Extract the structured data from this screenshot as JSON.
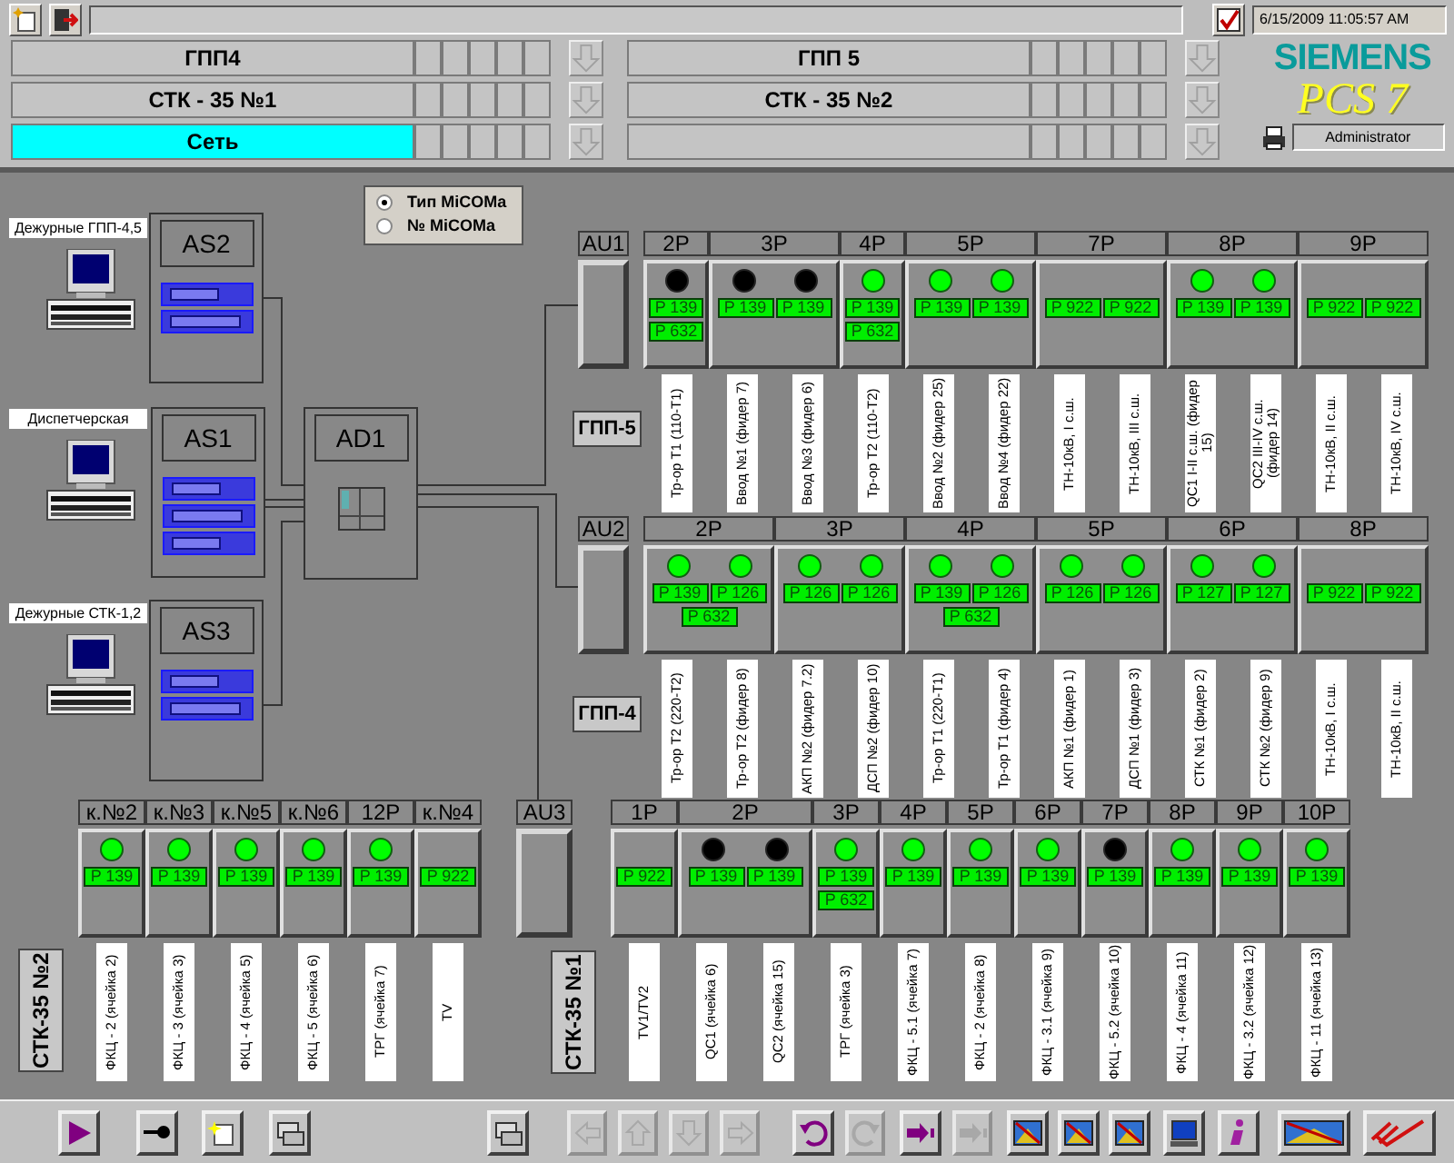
{
  "header": {
    "date_time": "6/15/2009 11:05:57 AM",
    "brand": "SIEMENS",
    "product": "PCS 7",
    "user": "Administrator"
  },
  "areas": [
    {
      "label": "ГПП4",
      "selected": false
    },
    {
      "label": "ГПП 5",
      "selected": false
    },
    {
      "label": "СТК - 35 №1",
      "selected": false
    },
    {
      "label": "СТК - 35 №2",
      "selected": false
    },
    {
      "label": "Сеть",
      "selected": true
    },
    {
      "selected": false
    }
  ],
  "network": {
    "view_options": [
      {
        "label": "Тип MiCOMa",
        "selected": true
      },
      {
        "label": "№ MiCOMa",
        "selected": false
      }
    ],
    "workstations": [
      {
        "label": "Дежурные ГПП-4,5"
      },
      {
        "label": "Диспетчерская"
      },
      {
        "label": "Дежурные СТК-1,2"
      }
    ],
    "servers": [
      {
        "name": "AS2"
      },
      {
        "name": "AS1"
      },
      {
        "name": "AS3"
      }
    ],
    "switch": {
      "name": "AD1"
    }
  },
  "relay_groups": [
    {
      "kind": "upper",
      "au": "AU1",
      "station": "ГПП-5",
      "cabinets": [
        {
          "name": "2P",
          "lamps": [
            {
              "on": false
            }
          ],
          "tags": [
            "P 139",
            "P 632"
          ],
          "labels": [
            "Тр-ор Т1 (110-Т1)"
          ]
        },
        {
          "name": "3P",
          "lamps": [
            {
              "on": false
            },
            {
              "on": false
            }
          ],
          "tags": [
            "P 139",
            "P 139"
          ],
          "labels": [
            "Ввод №1 (фидер 7)",
            "Ввод №3 (фидер 6)"
          ]
        },
        {
          "name": "4P",
          "lamps": [
            {
              "on": true
            }
          ],
          "tags": [
            "P 139",
            "P 632"
          ],
          "labels": [
            "Тр-ор Т2 (110-Т2)"
          ]
        },
        {
          "name": "5P",
          "lamps": [
            {
              "on": true
            },
            {
              "on": true
            }
          ],
          "tags": [
            "P 139",
            "P 139"
          ],
          "labels": [
            "Ввод №2 (фидер 25)",
            "Ввод №4 (фидер 22)"
          ]
        },
        {
          "name": "7P",
          "tags": [
            "P 922",
            "P 922"
          ],
          "labels": [
            "ТН-10кВ, I с.ш.",
            "ТН-10кВ, III с.ш."
          ]
        },
        {
          "name": "8P",
          "lamps": [
            {
              "on": true
            },
            {
              "on": true
            }
          ],
          "tags": [
            "P 139",
            "P 139"
          ],
          "labels": [
            "QC1 I-II с.ш. (фидер 15)",
            "QC2 III-IV с.ш. (фидер 14)"
          ]
        },
        {
          "name": "9P",
          "tags": [
            "P 922",
            "P 922"
          ],
          "labels": [
            "ТН-10кВ, II с.ш.",
            "ТН-10кВ, IV с.ш."
          ]
        }
      ]
    },
    {
      "kind": "upper",
      "au": "AU2",
      "station": "ГПП-4",
      "cabinets": [
        {
          "name": "2P",
          "lamps": [
            {
              "on": true
            },
            {
              "on": true
            }
          ],
          "tags": [
            "P 139",
            "P 126",
            "P 632"
          ],
          "labels": [
            "Тр-ор Т2 (220-Т2)",
            "Тр-ор Т2 (фидер 8)"
          ]
        },
        {
          "name": "3P",
          "lamps": [
            {
              "on": true
            },
            {
              "on": true
            }
          ],
          "tags": [
            "P 126",
            "P 126"
          ],
          "labels": [
            "АКП №2 (фидер 7.2)",
            "ДСП №2 (фидер 10)"
          ]
        },
        {
          "name": "4P",
          "lamps": [
            {
              "on": true
            },
            {
              "on": true
            }
          ],
          "tags": [
            "P 139",
            "P 126",
            "P 632"
          ],
          "labels": [
            "Тр-ор Т1 (220-Т1)",
            "Тр-ор Т1 (фидер 4)"
          ]
        },
        {
          "name": "5P",
          "lamps": [
            {
              "on": true
            },
            {
              "on": true
            }
          ],
          "tags": [
            "P 126",
            "P 126"
          ],
          "labels": [
            "АКП №1 (фидер 1)",
            "ДСП №1 (фидер 3)"
          ]
        },
        {
          "name": "6P",
          "lamps": [
            {
              "on": true
            },
            {
              "on": true
            }
          ],
          "tags": [
            "P 127",
            "P 127"
          ],
          "labels": [
            "СТК №1 (фидер 2)",
            "СТК №2 (фидер 9)"
          ]
        },
        {
          "name": "8P",
          "tags": [
            "P 922",
            "P 922"
          ],
          "labels": [
            "ТН-10кВ, I с.ш.",
            "ТН-10кВ, II с.ш."
          ]
        }
      ]
    },
    {
      "kind": "lower",
      "station": "СТК-35 №2",
      "cabinets": [
        {
          "name": "к.№2",
          "lamps": [
            {
              "on": true
            }
          ],
          "tags": [
            "P 139"
          ],
          "labels": [
            "ФКЦ - 2 (ячейка 2)"
          ]
        },
        {
          "name": "к.№3",
          "lamps": [
            {
              "on": true
            }
          ],
          "tags": [
            "P 139"
          ],
          "labels": [
            "ФКЦ - 3 (ячейка 3)"
          ]
        },
        {
          "name": "к.№5",
          "lamps": [
            {
              "on": true
            }
          ],
          "tags": [
            "P 139"
          ],
          "labels": [
            "ФКЦ - 4 (ячейка 5)"
          ]
        },
        {
          "name": "к.№6",
          "lamps": [
            {
              "on": true
            }
          ],
          "tags": [
            "P 139"
          ],
          "labels": [
            "ФКЦ - 5 (ячейка 6)"
          ]
        },
        {
          "name": "12P",
          "lamps": [
            {
              "on": true
            }
          ],
          "tags": [
            "P 139"
          ],
          "labels": [
            "ТРГ (ячейка 7)"
          ]
        },
        {
          "name": "к.№4",
          "tags": [
            "P 922"
          ],
          "labels": [
            "TV"
          ]
        }
      ]
    },
    {
      "kind": "lower",
      "au": "AU3",
      "station": "СТК-35 №1",
      "cabinets": [
        {
          "name": "1P",
          "tags": [
            "P 922"
          ],
          "labels": [
            "TV1/TV2"
          ]
        },
        {
          "name": "2P",
          "lamps": [
            {
              "on": false
            },
            {
              "on": false
            }
          ],
          "tags": [
            "P 139",
            "P 139"
          ],
          "labels": [
            "QC1 (ячейка 6)",
            "QC2 (ячейка 15)"
          ]
        },
        {
          "name": "3P",
          "lamps": [
            {
              "on": true
            }
          ],
          "tags": [
            "P 139",
            "P 632"
          ],
          "labels": [
            "ТРГ (ячейка 3)"
          ]
        },
        {
          "name": "4P",
          "lamps": [
            {
              "on": true
            }
          ],
          "tags": [
            "P 139"
          ],
          "labels": [
            "ФКЦ - 5.1 (ячейка 7)"
          ]
        },
        {
          "name": "5P",
          "lamps": [
            {
              "on": true
            }
          ],
          "tags": [
            "P 139"
          ],
          "labels": [
            "ФКЦ - 2 (ячейка 8)"
          ]
        },
        {
          "name": "6P",
          "lamps": [
            {
              "on": true
            }
          ],
          "tags": [
            "P 139"
          ],
          "labels": [
            "ФКЦ - 3.1 (ячейка 9)"
          ]
        },
        {
          "name": "7P",
          "lamps": [
            {
              "on": false
            }
          ],
          "tags": [
            "P 139"
          ],
          "labels": [
            "ФКЦ - 5.2 (ячейка 10)"
          ]
        },
        {
          "name": "8P",
          "lamps": [
            {
              "on": true
            }
          ],
          "tags": [
            "P 139"
          ],
          "labels": [
            "ФКЦ - 4 (ячейка 11)"
          ]
        },
        {
          "name": "9P",
          "lamps": [
            {
              "on": true
            }
          ],
          "tags": [
            "P 139"
          ],
          "labels": [
            "ФКЦ - 3.2 (ячейка 12)"
          ]
        },
        {
          "name": "10P",
          "lamps": [
            {
              "on": true
            }
          ],
          "tags": [
            "P 139"
          ],
          "labels": [
            "ФКЦ - 11 (ячейка 13)"
          ]
        }
      ]
    }
  ],
  "toolbar": [
    {
      "disabled": false
    },
    {
      "disabled": false
    },
    {
      "disabled": false
    },
    {
      "disabled": false
    },
    {
      "disabled": false
    },
    {
      "disabled": true
    },
    {
      "disabled": true
    },
    {
      "disabled": true
    },
    {
      "disabled": true
    },
    {
      "disabled": false
    },
    {
      "disabled": true
    },
    {
      "disabled": false
    },
    {
      "disabled": true
    },
    {
      "disabled": false
    },
    {
      "disabled": false
    },
    {
      "disabled": false
    },
    {
      "disabled": false
    },
    {
      "disabled": false
    },
    {
      "disabled": false
    },
    {
      "disabled": false
    }
  ]
}
